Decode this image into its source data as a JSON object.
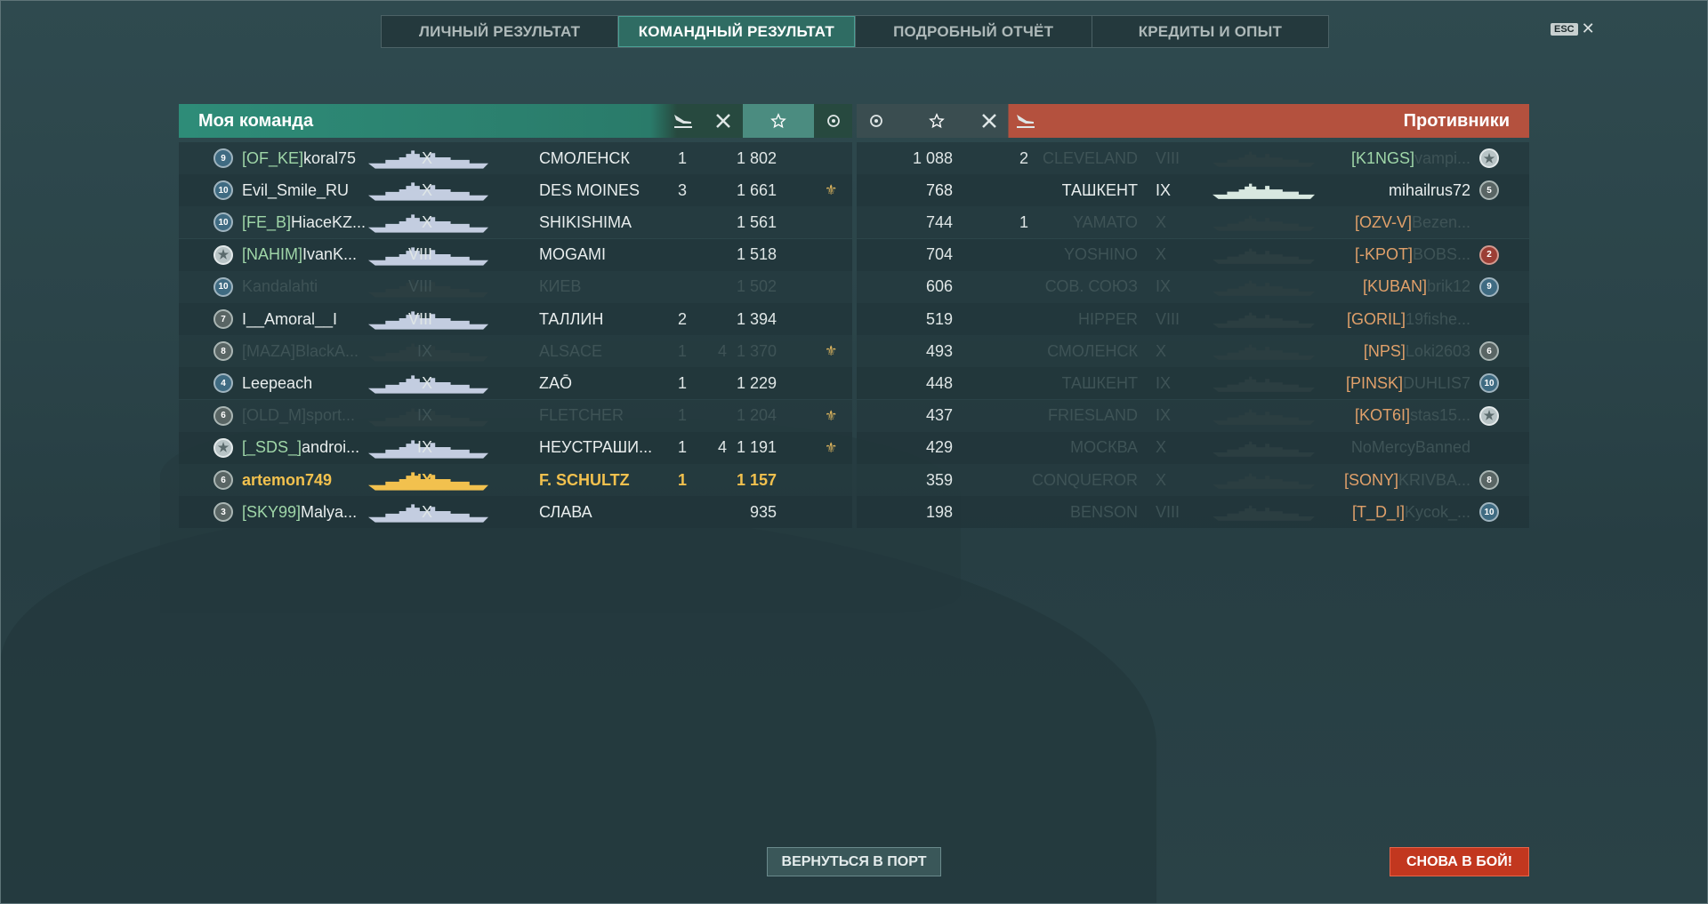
{
  "tabs": [
    {
      "label": "ЛИЧНЫЙ РЕЗУЛЬТАТ",
      "active": false
    },
    {
      "label": "КОМАНДНЫЙ РЕЗУЛЬТАТ",
      "active": true
    },
    {
      "label": "ПОДРОБНЫЙ ОТЧЁТ",
      "active": false
    },
    {
      "label": "КРЕДИТЫ И ОПЫТ",
      "active": false
    }
  ],
  "esc": {
    "key": "ESC",
    "close": "✕"
  },
  "my_team": {
    "title": "Моя команда",
    "color": "#2e8c78",
    "header_icons": [
      "planes-shot-icon",
      "ships-destroyed-icon",
      "base-xp-star-icon",
      "laurel-icon"
    ],
    "rows": [
      {
        "rank": "9",
        "clan": "[OF_KE]",
        "name": "koral75",
        "tier": "X",
        "ship": "СМОЛЕНСК",
        "planes": "1",
        "kills": "",
        "xp": "1 802",
        "laurel": false
      },
      {
        "rank": "10",
        "clan": "",
        "name": "Evil_Smile_RU",
        "tier": "X",
        "ship": "DES MOINES",
        "planes": "3",
        "kills": "",
        "xp": "1 661",
        "laurel": true
      },
      {
        "rank": "10",
        "clan": "[FE_B]",
        "name": "HiaceKZ...",
        "tier": "X",
        "ship": "SHIKISHIMA",
        "planes": "",
        "kills": "",
        "xp": "1 561",
        "laurel": false
      },
      {
        "rank": "★",
        "clan": "[NAHIM]",
        "name": "IvanK...",
        "tier": "VIII",
        "ship": "MOGAMI",
        "planes": "",
        "kills": "",
        "xp": "1 518",
        "laurel": false
      },
      {
        "rank": "10",
        "clan": "",
        "name": "Kandalahti",
        "tier": "VIII",
        "ship": "КИЕВ",
        "planes": "",
        "kills": "",
        "xp": "1 502",
        "laurel": false,
        "sunk": true
      },
      {
        "rank": "7",
        "clan": "",
        "name": "I__Amoral__I",
        "tier": "VIII",
        "ship": "ТАЛЛИН",
        "planes": "2",
        "kills": "",
        "xp": "1 394",
        "laurel": false
      },
      {
        "rank": "8",
        "clan": "[MAZA]",
        "name": "BlackA...",
        "tier": "IX",
        "ship": "ALSACE",
        "planes": "1",
        "kills": "4",
        "xp": "1 370",
        "laurel": true,
        "sunk": true
      },
      {
        "rank": "4",
        "clan": "",
        "name": "Leepeach",
        "tier": "X",
        "ship": "ZAŌ",
        "planes": "1",
        "kills": "",
        "xp": "1 229",
        "laurel": false
      },
      {
        "rank": "6",
        "clan": "[OLD_M]",
        "name": "sport...",
        "tier": "IX",
        "ship": "FLETCHER",
        "planes": "1",
        "kills": "",
        "xp": "1 204",
        "laurel": true,
        "sunk": true
      },
      {
        "rank": "★",
        "clan": "[_SDS_]",
        "name": "androi...",
        "tier": "IX",
        "ship": "НЕУСТРАШИ...",
        "planes": "1",
        "kills": "4",
        "xp": "1 191",
        "laurel": true
      },
      {
        "rank": "6",
        "clan": "",
        "name": "artemon749",
        "tier": "IX",
        "ship": "F. SCHULTZ",
        "planes": "1",
        "kills": "",
        "xp": "1 157",
        "laurel": false,
        "self": true
      },
      {
        "rank": "3",
        "clan": "[SKY99]",
        "name": "Malya...",
        "tier": "X",
        "ship": "СЛАВА",
        "planes": "",
        "kills": "",
        "xp": "935",
        "laurel": false
      }
    ]
  },
  "enemies": {
    "title": "Противники",
    "color": "#b4513e",
    "header_icons": [
      "laurel-icon",
      "base-xp-star-icon",
      "ships-destroyed-icon",
      "planes-shot-icon"
    ],
    "rows": [
      {
        "xp": "1 088",
        "kills": "",
        "planes": "2",
        "ship": "CLEVELAND",
        "tier": "VIII",
        "clan": "[K1NGS]",
        "name": "vampi...",
        "rank": "★",
        "sunk": true
      },
      {
        "xp": "768",
        "kills": "",
        "planes": "",
        "ship": "ТАШКЕНТ",
        "tier": "IX",
        "clan": "",
        "name": "mihailrus72",
        "rank": "5",
        "sunk": false
      },
      {
        "xp": "744",
        "kills": "",
        "planes": "1",
        "ship": "YAMATO",
        "tier": "X",
        "clan": "[OZV-V]",
        "name": "Bezen...",
        "rank": "",
        "sunk": true
      },
      {
        "xp": "704",
        "kills": "",
        "planes": "",
        "ship": "YOSHINO",
        "tier": "X",
        "clan": "[-KPOT]",
        "name": "BOBS...",
        "rank": "2",
        "sunk": true
      },
      {
        "xp": "606",
        "kills": "",
        "planes": "",
        "ship": "СОВ. СОЮЗ",
        "tier": "IX",
        "clan": "[KUBAN]",
        "name": "brik12",
        "rank": "9",
        "sunk": true
      },
      {
        "xp": "519",
        "kills": "",
        "planes": "",
        "ship": "HIPPER",
        "tier": "VIII",
        "clan": "[GORIL]",
        "name": "19fishe...",
        "rank": "",
        "sunk": true
      },
      {
        "xp": "493",
        "kills": "",
        "planes": "",
        "ship": "СМОЛЕНСК",
        "tier": "X",
        "clan": "[NPS]",
        "name": "Loki2603",
        "rank": "6",
        "sunk": true
      },
      {
        "xp": "448",
        "kills": "",
        "planes": "",
        "ship": "ТАШКЕНТ",
        "tier": "IX",
        "clan": "[PINSK]",
        "name": "DUHLIS7",
        "rank": "10",
        "sunk": true
      },
      {
        "xp": "437",
        "kills": "",
        "planes": "",
        "ship": "FRIESLAND",
        "tier": "IX",
        "clan": "[KOT6I]",
        "name": "stas15...",
        "rank": "★",
        "sunk": true
      },
      {
        "xp": "429",
        "kills": "",
        "planes": "",
        "ship": "МОСКВА",
        "tier": "X",
        "clan": "",
        "name": "NoMercyBanned",
        "rank": "",
        "sunk": true
      },
      {
        "xp": "359",
        "kills": "",
        "planes": "",
        "ship": "CONQUEROR",
        "tier": "X",
        "clan": "[SONY]",
        "name": "KRIVBA...",
        "rank": "8",
        "sunk": true
      },
      {
        "xp": "198",
        "kills": "",
        "planes": "",
        "ship": "BENSON",
        "tier": "VIII",
        "clan": "[T_D_I]",
        "name": "Kycok_...",
        "rank": "10",
        "sunk": true
      }
    ]
  },
  "buttons": {
    "port": "ВЕРНУТЬСЯ В ПОРТ",
    "battle": "СНОВА В БОЙ!"
  }
}
